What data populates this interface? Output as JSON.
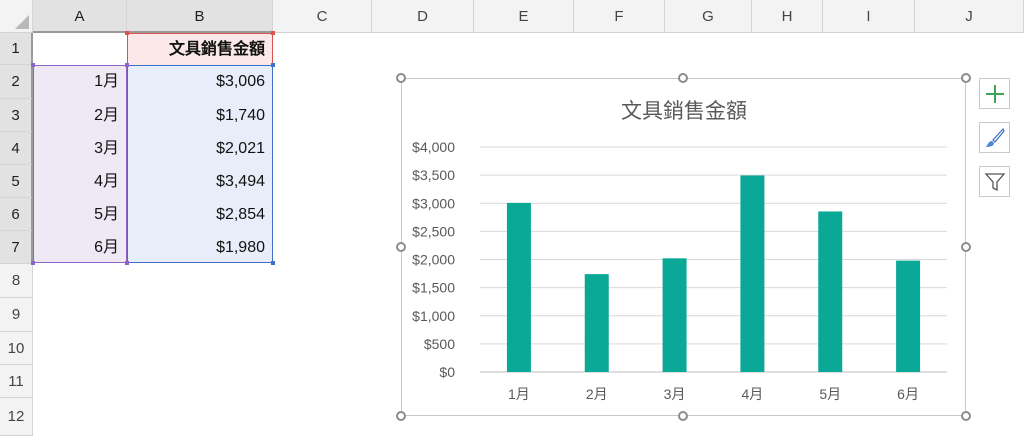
{
  "columns": [
    "A",
    "B",
    "C",
    "D",
    "E",
    "F",
    "G",
    "H",
    "I",
    "J"
  ],
  "rows": [
    "1",
    "2",
    "3",
    "4",
    "5",
    "6",
    "7",
    "8",
    "9",
    "10",
    "11",
    "12"
  ],
  "cells": {
    "B1": "文具銷售金額",
    "A": [
      "1月",
      "2月",
      "3月",
      "4月",
      "5月",
      "6月"
    ],
    "B": [
      "$3,006",
      "$1,740",
      "$2,021",
      "$3,494",
      "$2,854",
      "$1,980"
    ]
  },
  "colors": {
    "bar": "#0aa896",
    "rangeA": "#8f62c5",
    "rangeB": "#3d72c7",
    "rangeHeader": "#d9534f"
  },
  "side_buttons": {
    "add": "plus-icon",
    "style": "brush-icon",
    "filter": "funnel-icon"
  },
  "chart_data": {
    "type": "bar",
    "title": "文具銷售金額",
    "categories": [
      "1月",
      "2月",
      "3月",
      "4月",
      "5月",
      "6月"
    ],
    "values": [
      3006,
      1740,
      2021,
      3494,
      2854,
      1980
    ],
    "ylim": [
      0,
      4000
    ],
    "yticks": [
      "$0",
      "$500",
      "$1,000",
      "$1,500",
      "$2,000",
      "$2,500",
      "$3,000",
      "$3,500",
      "$4,000"
    ],
    "ytick_values": [
      0,
      500,
      1000,
      1500,
      2000,
      2500,
      3000,
      3500,
      4000
    ],
    "grid": true,
    "legend": "none"
  }
}
